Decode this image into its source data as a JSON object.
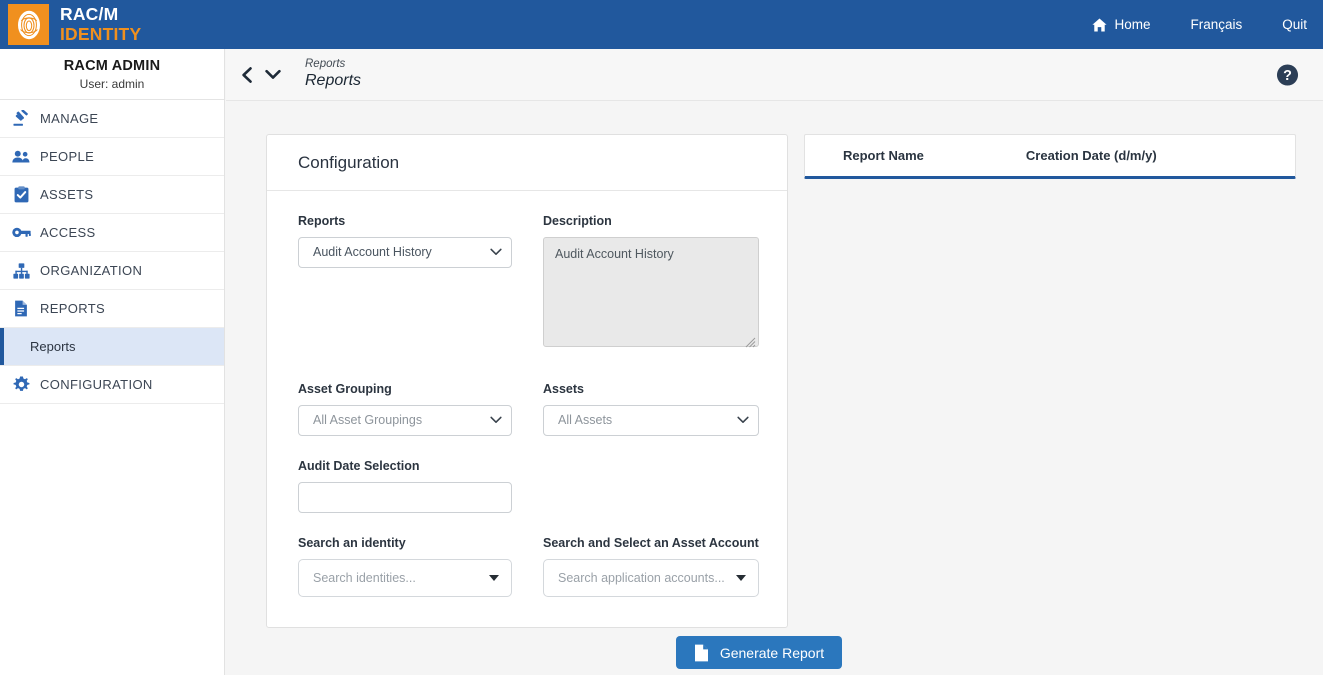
{
  "topbar": {
    "brand_line1": "RAC/M",
    "brand_line2": "IDENTITY",
    "nav": [
      {
        "label": "Home",
        "icon": "home-icon"
      },
      {
        "label": "Français",
        "icon": null
      },
      {
        "label": "Quit",
        "icon": null
      }
    ]
  },
  "sidebar": {
    "user_name": "RACM ADMIN",
    "user_sub": "User: admin",
    "items": [
      {
        "label": "MANAGE",
        "icon": "gavel-icon"
      },
      {
        "label": "PEOPLE",
        "icon": "people-icon"
      },
      {
        "label": "ASSETS",
        "icon": "clipboard-check-icon"
      },
      {
        "label": "ACCESS",
        "icon": "key-icon"
      },
      {
        "label": "ORGANIZATION",
        "icon": "sitemap-icon"
      },
      {
        "label": "REPORTS",
        "icon": "file-icon"
      }
    ],
    "active_sub_item": "Reports",
    "last_item": {
      "label": "CONFIGURATION",
      "icon": "gear-icon"
    }
  },
  "breadcrumb": {
    "parent": "Reports",
    "current": "Reports"
  },
  "configuration": {
    "panel_title": "Configuration",
    "reports_label": "Reports",
    "reports_value": "Audit Account History",
    "description_label": "Description",
    "description_value": "Audit Account History",
    "asset_grouping_label": "Asset Grouping",
    "asset_grouping_value": "All Asset Groupings",
    "assets_label": "Assets",
    "assets_value": "All Assets",
    "audit_date_label": "Audit Date Selection",
    "audit_date_value": "",
    "audit_date_placeholder": "",
    "search_identity_label": "Search an identity",
    "search_identity_placeholder": "Search identities...",
    "search_asset_account_label": "Search and Select an Asset Account",
    "search_asset_account_placeholder": "Search application accounts..."
  },
  "results": {
    "col_report_name": "Report Name",
    "col_creation_date": "Creation Date (d/m/y)",
    "rows": []
  },
  "actions": {
    "generate_report": "Generate Report"
  },
  "colors": {
    "header_blue": "#21589d",
    "brand_orange": "#f0901f",
    "accent_blue": "#2b77bd",
    "active_nav_bg": "#dce6f6",
    "page_bg": "#f5f5f5"
  }
}
